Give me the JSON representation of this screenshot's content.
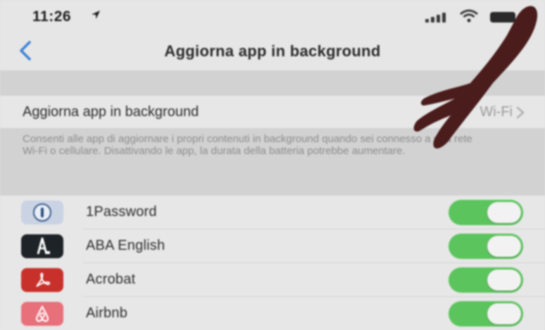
{
  "status_bar": {
    "time": "11:26",
    "location_icon": "location-arrow-icon",
    "signal_icon": "cellular-signal-icon",
    "wifi_icon": "wifi-icon",
    "battery_icon": "battery-icon"
  },
  "nav": {
    "back_icon": "chevron-left-icon",
    "title": "Aggiorna app in background"
  },
  "main_setting": {
    "label": "Aggiorna app in background",
    "value": "Wi-Fi",
    "chevron_icon": "chevron-right-icon"
  },
  "footer": {
    "text": "Consenti alle app di aggiornare i propri contenuti in background quando sei connesso a una rete Wi-Fi o cellulare. Disattivando le app, la durata della batteria potrebbe aumentare."
  },
  "apps": [
    {
      "name": "1Password",
      "icon": "1password-icon",
      "enabled": true
    },
    {
      "name": "ABA English",
      "icon": "aba-english-icon",
      "enabled": true
    },
    {
      "name": "Acrobat",
      "icon": "acrobat-icon",
      "enabled": true
    },
    {
      "name": "Airbnb",
      "icon": "airbnb-icon",
      "enabled": true
    }
  ],
  "colors": {
    "accent": "#3a82d6",
    "toggle_on": "#5cc45d",
    "background": "#dedede"
  }
}
